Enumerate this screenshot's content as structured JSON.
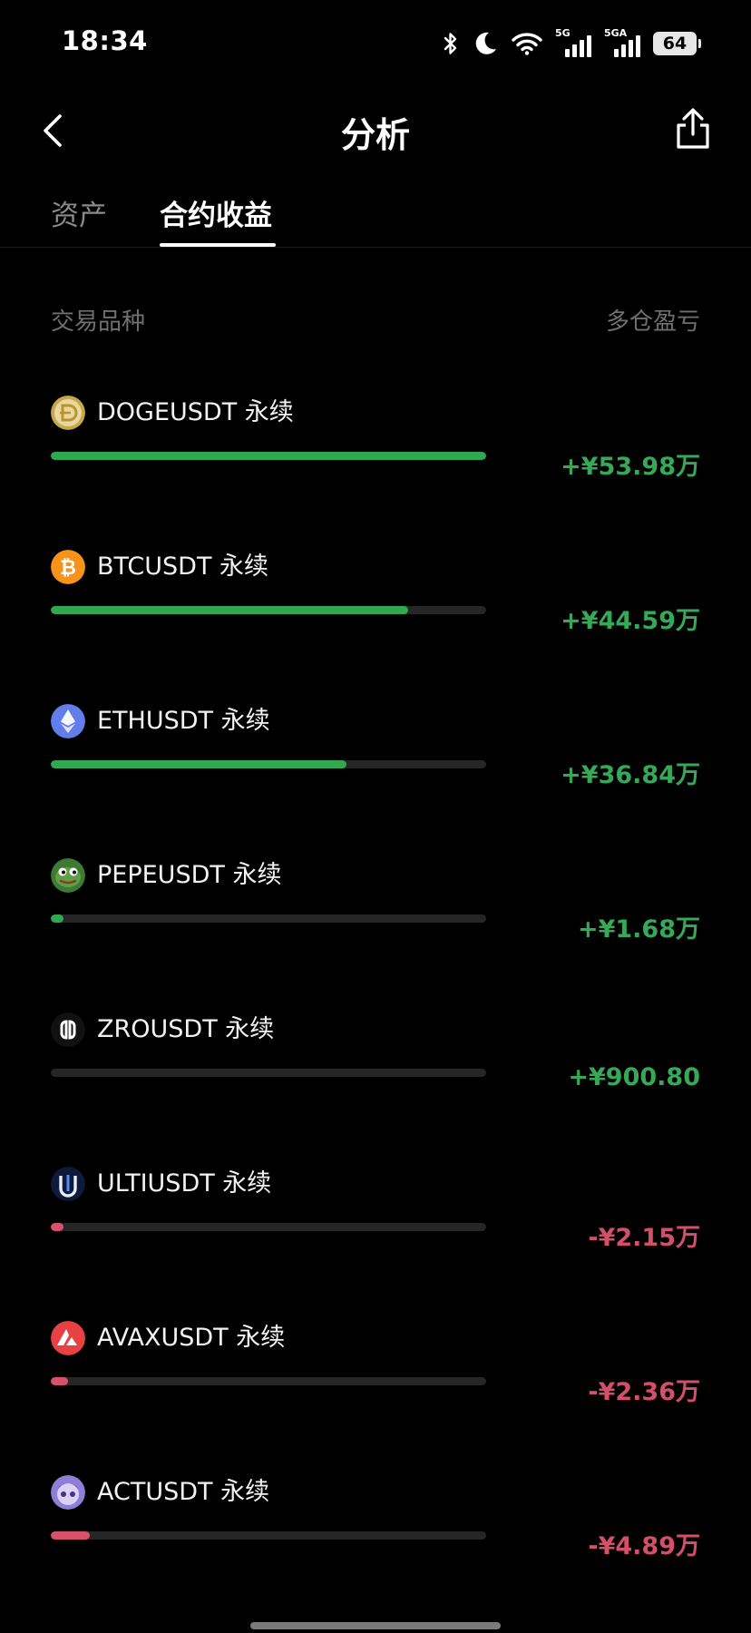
{
  "status_bar": {
    "time": "18:34",
    "icons": [
      "bluetooth-icon",
      "moon-icon",
      "wifi-icon"
    ],
    "network_1": "5G",
    "network_2": "5GA",
    "battery": "64"
  },
  "nav": {
    "title": "分析",
    "back_icon": "chevron-left-icon",
    "share_icon": "share-icon"
  },
  "tabs": [
    {
      "label": "资产",
      "active": false
    },
    {
      "label": "合约收益",
      "active": true
    }
  ],
  "list_header": {
    "left": "交易品种",
    "right": "多仓盈亏"
  },
  "colors": {
    "positive": "#35a957",
    "negative": "#d45069",
    "track": "#262626"
  },
  "items": [
    {
      "name": "DOGEUSDT 永续",
      "pnl": "+¥53.98万",
      "sign": "pos",
      "progress": 1.0,
      "icon": "doge-coin-icon"
    },
    {
      "name": "BTCUSDT 永续",
      "pnl": "+¥44.59万",
      "sign": "pos",
      "progress": 0.82,
      "icon": "btc-coin-icon"
    },
    {
      "name": "ETHUSDT 永续",
      "pnl": "+¥36.84万",
      "sign": "pos",
      "progress": 0.68,
      "icon": "eth-coin-icon"
    },
    {
      "name": "PEPEUSDT 永续",
      "pnl": "+¥1.68万",
      "sign": "pos",
      "progress": 0.03,
      "icon": "pepe-coin-icon"
    },
    {
      "name": "ZROUSDT 永续",
      "pnl": "+¥900.80",
      "sign": "pos",
      "progress": 0.0,
      "icon": "zro-coin-icon"
    },
    {
      "name": "ULTIUSDT 永续",
      "pnl": "-¥2.15万",
      "sign": "neg",
      "progress": 0.03,
      "icon": "ulti-coin-icon"
    },
    {
      "name": "AVAXUSDT 永续",
      "pnl": "-¥2.36万",
      "sign": "neg",
      "progress": 0.04,
      "icon": "avax-coin-icon"
    },
    {
      "name": "ACTUSDT 永续",
      "pnl": "-¥4.89万",
      "sign": "neg",
      "progress": 0.09,
      "icon": "act-coin-icon"
    }
  ]
}
